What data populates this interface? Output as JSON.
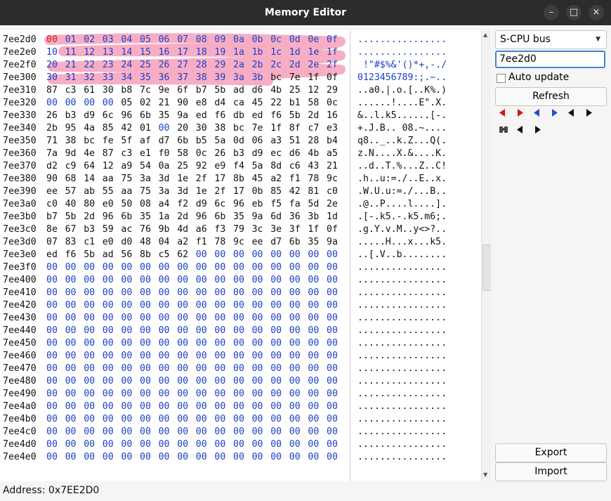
{
  "window": {
    "title": "Memory Editor"
  },
  "bus": {
    "selected": "S-CPU bus"
  },
  "address_input": {
    "value": "7ee2d0"
  },
  "auto_update": {
    "label": "Auto update",
    "checked": false
  },
  "buttons": {
    "refresh": "Refresh",
    "export": "Export",
    "import": "Import"
  },
  "status": {
    "address": "Address: 0x7EE2D0"
  },
  "highlight_color": "#f7aac1",
  "rows": [
    {
      "addr": "7ee2d0",
      "bytes": "00 01 02 03 04 05 06 07 08 09 0a 0b 0c 0d 0e 0f",
      "ascii": "................"
    },
    {
      "addr": "7ee2e0",
      "bytes": "10 11 12 13 14 15 16 17 18 19 1a 1b 1c 1d 1e 1f",
      "ascii": "................"
    },
    {
      "addr": "7ee2f0",
      "bytes": "20 21 22 23 24 25 26 27 28 29 2a 2b 2c 2d 2e 2f",
      "ascii": " !\"#$%&'()*+,-./"
    },
    {
      "addr": "7ee300",
      "bytes": "30 31 32 33 34 35 36 37 38 39 3a 3b bc 7e 1f 0f",
      "ascii": "0123456789:;.~.."
    },
    {
      "addr": "7ee310",
      "bytes": "87 c3 61 30 b8 7c 9e 6f b7 5b ad d6 4b 25 12 29",
      "ascii": "..a0.|.o.[..K%.)"
    },
    {
      "addr": "7ee320",
      "bytes": "00 00 00 00 05 02 21 90 e8 d4 ca 45 22 b1 58 0c",
      "ascii": "......!....E\".X."
    },
    {
      "addr": "7ee330",
      "bytes": "26 b3 d9 6c 96 6b 35 9a ed f6 db ed f6 5b 2d 16",
      "ascii": "&..l.k5......[-."
    },
    {
      "addr": "7ee340",
      "bytes": "2b 95 4a 85 42 01 00 20 30 38 bc 7e 1f 8f c7 e3",
      "ascii": "+.J.B.. 08.~...."
    },
    {
      "addr": "7ee350",
      "bytes": "71 38 bc fe 5f af d7 6b b5 5a 0d 06 a3 51 28 b4",
      "ascii": "q8.._..k.Z...Q(."
    },
    {
      "addr": "7ee360",
      "bytes": "7a 9d 4e 87 c3 e1 f0 58 0c 26 b3 d9 ec d6 4b a5",
      "ascii": "z.N....X.&....K."
    },
    {
      "addr": "7ee370",
      "bytes": "d2 c9 64 12 a9 54 0a 25 92 e9 f4 5a 8d c6 43 21",
      "ascii": "..d..T.%...Z..C!"
    },
    {
      "addr": "7ee380",
      "bytes": "90 68 14 aa 75 3a 3d 1e 2f 17 8b 45 a2 f1 78 9c",
      "ascii": ".h..u:=./..E..x."
    },
    {
      "addr": "7ee390",
      "bytes": "ee 57 ab 55 aa 75 3a 3d 1e 2f 17 0b 85 42 81 c0",
      "ascii": ".W.U.u:=./...B.."
    },
    {
      "addr": "7ee3a0",
      "bytes": "c0 40 80 e0 50 08 a4 f2 d9 6c 96 eb f5 fa 5d 2e",
      "ascii": ".@..P....l....]."
    },
    {
      "addr": "7ee3b0",
      "bytes": "b7 5b 2d 96 6b 35 1a 2d 96 6b 35 9a 6d 36 3b 1d",
      "ascii": ".[-.k5.-.k5.m6;."
    },
    {
      "addr": "7ee3c0",
      "bytes": "8e 67 b3 59 ac 76 9b 4d a6 f3 79 3c 3e 3f 1f 0f",
      "ascii": ".g.Y.v.M..y<>?.."
    },
    {
      "addr": "7ee3d0",
      "bytes": "07 83 c1 e0 d0 48 04 a2 f1 78 9c ee d7 6b 35 9a",
      "ascii": ".....H...x...k5."
    },
    {
      "addr": "7ee3e0",
      "bytes": "ed f6 5b ad 56 8b c5 62 00 00 00 00 00 00 00 00",
      "ascii": "..[.V..b........"
    },
    {
      "addr": "7ee3f0",
      "bytes": "00 00 00 00 00 00 00 00 00 00 00 00 00 00 00 00",
      "ascii": "................"
    },
    {
      "addr": "7ee400",
      "bytes": "00 00 00 00 00 00 00 00 00 00 00 00 00 00 00 00",
      "ascii": "................"
    },
    {
      "addr": "7ee410",
      "bytes": "00 00 00 00 00 00 00 00 00 00 00 00 00 00 00 00",
      "ascii": "................"
    },
    {
      "addr": "7ee420",
      "bytes": "00 00 00 00 00 00 00 00 00 00 00 00 00 00 00 00",
      "ascii": "................"
    },
    {
      "addr": "7ee430",
      "bytes": "00 00 00 00 00 00 00 00 00 00 00 00 00 00 00 00",
      "ascii": "................"
    },
    {
      "addr": "7ee440",
      "bytes": "00 00 00 00 00 00 00 00 00 00 00 00 00 00 00 00",
      "ascii": "................"
    },
    {
      "addr": "7ee450",
      "bytes": "00 00 00 00 00 00 00 00 00 00 00 00 00 00 00 00",
      "ascii": "................"
    },
    {
      "addr": "7ee460",
      "bytes": "00 00 00 00 00 00 00 00 00 00 00 00 00 00 00 00",
      "ascii": "................"
    },
    {
      "addr": "7ee470",
      "bytes": "00 00 00 00 00 00 00 00 00 00 00 00 00 00 00 00",
      "ascii": "................"
    },
    {
      "addr": "7ee480",
      "bytes": "00 00 00 00 00 00 00 00 00 00 00 00 00 00 00 00",
      "ascii": "................"
    },
    {
      "addr": "7ee490",
      "bytes": "00 00 00 00 00 00 00 00 00 00 00 00 00 00 00 00",
      "ascii": "................"
    },
    {
      "addr": "7ee4a0",
      "bytes": "00 00 00 00 00 00 00 00 00 00 00 00 00 00 00 00",
      "ascii": "................"
    },
    {
      "addr": "7ee4b0",
      "bytes": "00 00 00 00 00 00 00 00 00 00 00 00 00 00 00 00",
      "ascii": "................"
    },
    {
      "addr": "7ee4c0",
      "bytes": "00 00 00 00 00 00 00 00 00 00 00 00 00 00 00 00",
      "ascii": "................"
    },
    {
      "addr": "7ee4d0",
      "bytes": "00 00 00 00 00 00 00 00 00 00 00 00 00 00 00 00",
      "ascii": "................"
    },
    {
      "addr": "7ee4e0",
      "bytes": "00 00 00 00 00 00 00 00 00 00 00 00 00 00 00 00",
      "ascii": "................"
    }
  ]
}
